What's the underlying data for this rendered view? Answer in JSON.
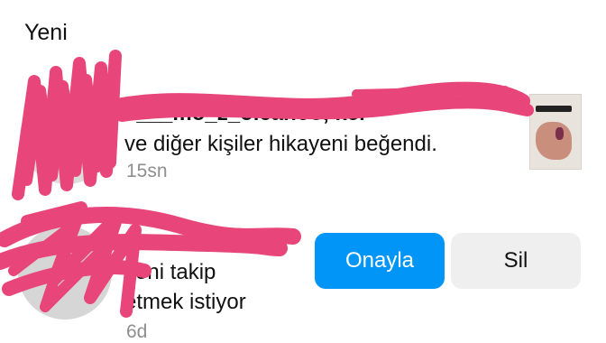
{
  "section": {
    "title": "Yeni"
  },
  "notifications": [
    {
      "type": "story-like",
      "usernames": "a___mo_z_olcanoo, kel",
      "usernames_tail": "oo",
      "text": "ve diğer kişiler hikayeni beğendi.",
      "time": "15sn"
    },
    {
      "type": "follow-request",
      "username": "",
      "text_line1": "seni takip",
      "text_line2": "etmek istiyor",
      "time": "6d",
      "confirm_label": "Onayla",
      "delete_label": "Sil"
    }
  ],
  "colors": {
    "primary": "#0095f6",
    "secondary_button": "#efefef",
    "muted_text": "#8e8e8e",
    "redaction": "#e8457a"
  },
  "icons": {
    "story_thumbnail": "hand-nails-thumbnail"
  }
}
